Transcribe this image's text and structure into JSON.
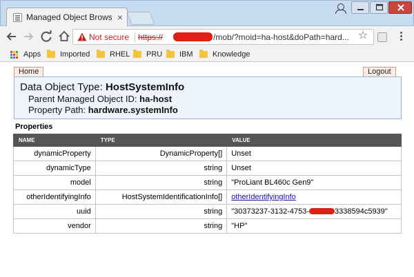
{
  "browser": {
    "tab_title": "Managed Object Browse",
    "tab_close": "×",
    "not_secure_label": "Not secure",
    "url_scheme": "https://",
    "url_rest": "/mob/?moid=ha-host&doPath=hard...",
    "bookmarks": [
      {
        "label": "Apps",
        "icon": "apps-grid-icon"
      },
      {
        "label": "Imported",
        "icon": "folder-icon"
      },
      {
        "label": "RHEL",
        "icon": "folder-icon"
      },
      {
        "label": "PRU",
        "icon": "folder-icon"
      },
      {
        "label": "IBM",
        "icon": "folder-icon"
      },
      {
        "label": "Knowledge",
        "icon": "folder-icon"
      }
    ],
    "colors": {
      "not_secure": "#c5221f",
      "redaction": "#e02016",
      "frame": "#c8dcf1"
    }
  },
  "page": {
    "home_label": "Home",
    "logout_label": "Logout",
    "data_object_type_label": "Data Object Type: ",
    "data_object_type_value": "HostSystemInfo",
    "parent_id_label": "Parent Managed Object ID: ",
    "parent_id_value": "ha-host",
    "property_path_label": "Property Path: ",
    "property_path_value": "hardware.systemInfo",
    "properties_heading": "Properties",
    "columns": [
      "NAME",
      "TYPE",
      "VALUE"
    ],
    "rows": [
      {
        "name": "dynamicProperty",
        "type": "DynamicProperty[]",
        "value": "Unset"
      },
      {
        "name": "dynamicType",
        "type": "string",
        "value": "Unset"
      },
      {
        "name": "model",
        "type": "string",
        "value": "\"ProLiant BL460c Gen9\""
      },
      {
        "name": "otherIdentifyingInfo",
        "type": "HostSystemIdentificationInfo[]",
        "value": "otherIdentifyingInfo"
      },
      {
        "name": "uuid",
        "type": "string",
        "value_start": "\"30373237-3132-4753-",
        "value_end": "3338594c5939\""
      },
      {
        "name": "vendor",
        "type": "string",
        "value": "\"HP\""
      }
    ]
  }
}
